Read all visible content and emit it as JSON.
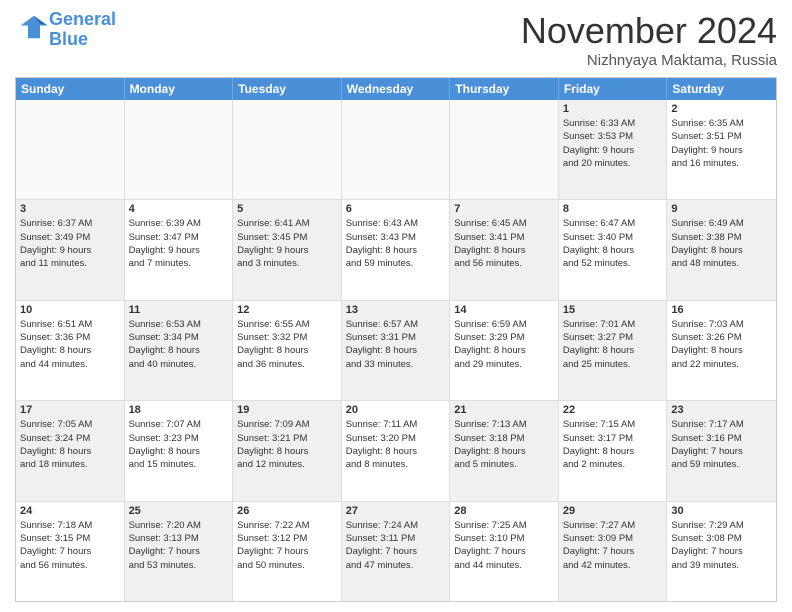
{
  "header": {
    "logo_line1": "General",
    "logo_line2": "Blue",
    "month": "November 2024",
    "location": "Nizhnyaya Maktama, Russia"
  },
  "weekdays": [
    "Sunday",
    "Monday",
    "Tuesday",
    "Wednesday",
    "Thursday",
    "Friday",
    "Saturday"
  ],
  "rows": [
    [
      {
        "day": "",
        "info": "",
        "empty": true
      },
      {
        "day": "",
        "info": "",
        "empty": true
      },
      {
        "day": "",
        "info": "",
        "empty": true
      },
      {
        "day": "",
        "info": "",
        "empty": true
      },
      {
        "day": "",
        "info": "",
        "empty": true
      },
      {
        "day": "1",
        "info": "Sunrise: 6:33 AM\nSunset: 3:53 PM\nDaylight: 9 hours\nand 20 minutes.",
        "empty": false,
        "shaded": true
      },
      {
        "day": "2",
        "info": "Sunrise: 6:35 AM\nSunset: 3:51 PM\nDaylight: 9 hours\nand 16 minutes.",
        "empty": false,
        "shaded": false
      }
    ],
    [
      {
        "day": "3",
        "info": "Sunrise: 6:37 AM\nSunset: 3:49 PM\nDaylight: 9 hours\nand 11 minutes.",
        "empty": false,
        "shaded": true
      },
      {
        "day": "4",
        "info": "Sunrise: 6:39 AM\nSunset: 3:47 PM\nDaylight: 9 hours\nand 7 minutes.",
        "empty": false,
        "shaded": false
      },
      {
        "day": "5",
        "info": "Sunrise: 6:41 AM\nSunset: 3:45 PM\nDaylight: 9 hours\nand 3 minutes.",
        "empty": false,
        "shaded": true
      },
      {
        "day": "6",
        "info": "Sunrise: 6:43 AM\nSunset: 3:43 PM\nDaylight: 8 hours\nand 59 minutes.",
        "empty": false,
        "shaded": false
      },
      {
        "day": "7",
        "info": "Sunrise: 6:45 AM\nSunset: 3:41 PM\nDaylight: 8 hours\nand 56 minutes.",
        "empty": false,
        "shaded": true
      },
      {
        "day": "8",
        "info": "Sunrise: 6:47 AM\nSunset: 3:40 PM\nDaylight: 8 hours\nand 52 minutes.",
        "empty": false,
        "shaded": false
      },
      {
        "day": "9",
        "info": "Sunrise: 6:49 AM\nSunset: 3:38 PM\nDaylight: 8 hours\nand 48 minutes.",
        "empty": false,
        "shaded": true
      }
    ],
    [
      {
        "day": "10",
        "info": "Sunrise: 6:51 AM\nSunset: 3:36 PM\nDaylight: 8 hours\nand 44 minutes.",
        "empty": false,
        "shaded": false
      },
      {
        "day": "11",
        "info": "Sunrise: 6:53 AM\nSunset: 3:34 PM\nDaylight: 8 hours\nand 40 minutes.",
        "empty": false,
        "shaded": true
      },
      {
        "day": "12",
        "info": "Sunrise: 6:55 AM\nSunset: 3:32 PM\nDaylight: 8 hours\nand 36 minutes.",
        "empty": false,
        "shaded": false
      },
      {
        "day": "13",
        "info": "Sunrise: 6:57 AM\nSunset: 3:31 PM\nDaylight: 8 hours\nand 33 minutes.",
        "empty": false,
        "shaded": true
      },
      {
        "day": "14",
        "info": "Sunrise: 6:59 AM\nSunset: 3:29 PM\nDaylight: 8 hours\nand 29 minutes.",
        "empty": false,
        "shaded": false
      },
      {
        "day": "15",
        "info": "Sunrise: 7:01 AM\nSunset: 3:27 PM\nDaylight: 8 hours\nand 25 minutes.",
        "empty": false,
        "shaded": true
      },
      {
        "day": "16",
        "info": "Sunrise: 7:03 AM\nSunset: 3:26 PM\nDaylight: 8 hours\nand 22 minutes.",
        "empty": false,
        "shaded": false
      }
    ],
    [
      {
        "day": "17",
        "info": "Sunrise: 7:05 AM\nSunset: 3:24 PM\nDaylight: 8 hours\nand 18 minutes.",
        "empty": false,
        "shaded": true
      },
      {
        "day": "18",
        "info": "Sunrise: 7:07 AM\nSunset: 3:23 PM\nDaylight: 8 hours\nand 15 minutes.",
        "empty": false,
        "shaded": false
      },
      {
        "day": "19",
        "info": "Sunrise: 7:09 AM\nSunset: 3:21 PM\nDaylight: 8 hours\nand 12 minutes.",
        "empty": false,
        "shaded": true
      },
      {
        "day": "20",
        "info": "Sunrise: 7:11 AM\nSunset: 3:20 PM\nDaylight: 8 hours\nand 8 minutes.",
        "empty": false,
        "shaded": false
      },
      {
        "day": "21",
        "info": "Sunrise: 7:13 AM\nSunset: 3:18 PM\nDaylight: 8 hours\nand 5 minutes.",
        "empty": false,
        "shaded": true
      },
      {
        "day": "22",
        "info": "Sunrise: 7:15 AM\nSunset: 3:17 PM\nDaylight: 8 hours\nand 2 minutes.",
        "empty": false,
        "shaded": false
      },
      {
        "day": "23",
        "info": "Sunrise: 7:17 AM\nSunset: 3:16 PM\nDaylight: 7 hours\nand 59 minutes.",
        "empty": false,
        "shaded": true
      }
    ],
    [
      {
        "day": "24",
        "info": "Sunrise: 7:18 AM\nSunset: 3:15 PM\nDaylight: 7 hours\nand 56 minutes.",
        "empty": false,
        "shaded": false
      },
      {
        "day": "25",
        "info": "Sunrise: 7:20 AM\nSunset: 3:13 PM\nDaylight: 7 hours\nand 53 minutes.",
        "empty": false,
        "shaded": true
      },
      {
        "day": "26",
        "info": "Sunrise: 7:22 AM\nSunset: 3:12 PM\nDaylight: 7 hours\nand 50 minutes.",
        "empty": false,
        "shaded": false
      },
      {
        "day": "27",
        "info": "Sunrise: 7:24 AM\nSunset: 3:11 PM\nDaylight: 7 hours\nand 47 minutes.",
        "empty": false,
        "shaded": true
      },
      {
        "day": "28",
        "info": "Sunrise: 7:25 AM\nSunset: 3:10 PM\nDaylight: 7 hours\nand 44 minutes.",
        "empty": false,
        "shaded": false
      },
      {
        "day": "29",
        "info": "Sunrise: 7:27 AM\nSunset: 3:09 PM\nDaylight: 7 hours\nand 42 minutes.",
        "empty": false,
        "shaded": true
      },
      {
        "day": "30",
        "info": "Sunrise: 7:29 AM\nSunset: 3:08 PM\nDaylight: 7 hours\nand 39 minutes.",
        "empty": false,
        "shaded": false
      }
    ]
  ]
}
